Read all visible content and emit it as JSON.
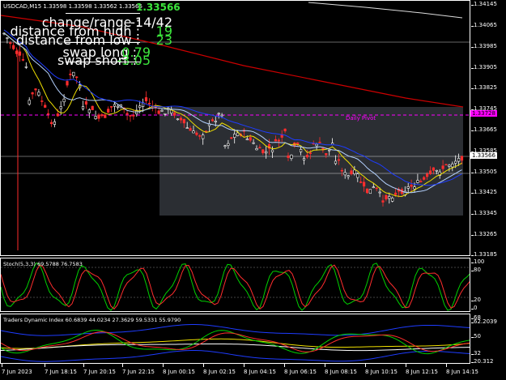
{
  "chart": {
    "symbol_line": "USDCAD,M15  1.33598 1.33598 1.33562 1.33566",
    "big_price": "1.33566",
    "info": [
      {
        "label": "change/range :",
        "value": "-14/42",
        "color": "#ffffff"
      },
      {
        "label": "distance from high :",
        "value": "19",
        "color": "#3ce63c"
      },
      {
        "label": "distance from low :",
        "value": "23",
        "color": "#3ce63c"
      },
      {
        "label": "swap long :",
        "value": "0.79",
        "color": "#3ce63c"
      },
      {
        "label": "swap short :",
        "value": "-3.05",
        "color": "#3ce63c"
      }
    ],
    "pivot_label": "Daily Pivot",
    "pivot_tag": "1.33728",
    "current_tag": "1.33566",
    "price_ticks": [
      "1.34145",
      "1.34065",
      "1.33985",
      "1.33905",
      "1.33825",
      "1.33745",
      "1.33665",
      "1.33585",
      "1.33505",
      "1.33425",
      "1.33345",
      "1.33265",
      "1.33185"
    ],
    "colors": {
      "bull": "#ffffff",
      "bear": "#ff2d2d",
      "ma_red": "#cc0000",
      "ma_blue": "#1e3cff",
      "ma_light": "#b4d2ff",
      "ma_yellow": "#f0e000",
      "pivot": "#ff00ff",
      "zone": "#2b2e33"
    }
  },
  "stoch": {
    "label": "Stoch(5,3,3) 69.5788 76.7583",
    "ticks": [
      "100",
      "80",
      "20",
      "0"
    ],
    "colors": {
      "main": "#00d200",
      "signal": "#ff2d2d"
    }
  },
  "tdi": {
    "label": "Traders Dynamic Index 60.6839 44.0234 27.3629 59.5331 55.9790",
    "ticks": [
      "68",
      "62.2039",
      "50",
      "32",
      "20.312"
    ],
    "colors": {
      "upper": "#1e3cff",
      "rsi": "#00d200",
      "signal": "#ff2d2d",
      "mid": "#f0e000",
      "base": "#ffffff"
    }
  },
  "time_axis": [
    "7 Jun 2023",
    "7 Jun 18:15",
    "7 Jun 20:15",
    "7 Jun 22:15",
    "8 Jun 00:15",
    "8 Jun 02:15",
    "8 Jun 04:15",
    "8 Jun 06:15",
    "8 Jun 08:15",
    "8 Jun 10:15",
    "8 Jun 12:15",
    "8 Jun 14:15"
  ]
}
